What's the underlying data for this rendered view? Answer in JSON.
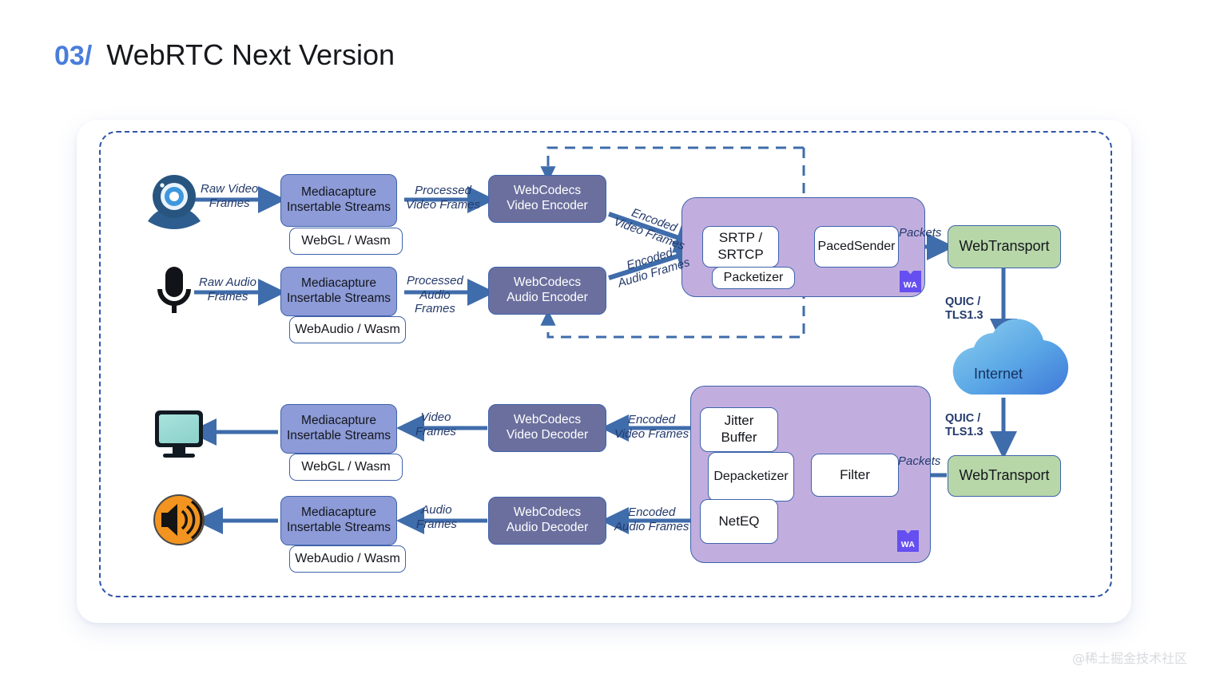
{
  "slide": {
    "number": "03/",
    "title": "WebRTC Next Version",
    "watermark": "@稀土掘金技术社区",
    "accent_blue": "#4a7ddb",
    "frame_blue": "#2f55a4",
    "mediacapture_fill": "#8d9bd8",
    "codec_fill": "#6b6f9e",
    "container_fill": "#c1aedf",
    "webtransport_fill": "#b7d7a8",
    "arrow_color": "#3f6cab",
    "wasm_badge_color": "#654ff0"
  },
  "send_path": {
    "camera_icon": "webcam-icon",
    "mic_icon": "microphone-icon",
    "video_capture": {
      "line1": "Mediacapture",
      "line2": "Insertable Streams",
      "sub": "WebGL / Wasm"
    },
    "audio_capture": {
      "line1": "Mediacapture",
      "line2": "Insertable Streams",
      "sub": "WebAudio / Wasm"
    },
    "video_encoder": {
      "line1": "WebCodecs",
      "line2": "Video Encoder"
    },
    "audio_encoder": {
      "line1": "WebCodecs",
      "line2": "Audio Encoder"
    },
    "labels": {
      "raw_video": "Raw Video\nFrames",
      "raw_video_l1": "Raw Video",
      "raw_video_l2": "Frames",
      "raw_audio_l1": "Raw Audio",
      "raw_audio_l2": "Frames",
      "processed_video_l1": "Processed",
      "processed_video_l2": "Video Frames",
      "processed_audio_l1": "Processed",
      "processed_audio_l2": "Audio",
      "processed_audio_l3": "Frames",
      "encoded_video_l1": "Encoded",
      "encoded_video_l2": "Video Frames",
      "encoded_audio_l1": "Encoded",
      "encoded_audio_l2": "Audio Frames",
      "packets": "Packets"
    },
    "transport_stack": {
      "srtp": "SRTP /\nSRTCP",
      "srtp_l1": "SRTP /",
      "srtp_l2": "SRTCP",
      "packetizer": "Packetizer",
      "paced_sender": "PacedSender",
      "wasm_badge": "WA"
    },
    "webtransport": "WebTransport"
  },
  "network": {
    "quic_upper_l1": "QUIC /",
    "quic_upper_l2": "TLS1.3",
    "quic_lower_l1": "QUIC /",
    "quic_lower_l2": "TLS1.3",
    "cloud_label": "Internet",
    "cloud_icon": "cloud-icon"
  },
  "receive_path": {
    "screen_icon": "monitor-icon",
    "speaker_icon": "speaker-icon",
    "webtransport": "WebTransport",
    "receive_stack": {
      "jitter_buffer_l1": "Jitter",
      "jitter_buffer_l2": "Buffer",
      "depacketizer": "Depacketizer",
      "neteq": "NetEQ",
      "filter": "Filter",
      "wasm_badge": "WA"
    },
    "video_decoder": {
      "line1": "WebCodecs",
      "line2": "Video Decoder"
    },
    "audio_decoder": {
      "line1": "WebCodecs",
      "line2": "Audio Decoder"
    },
    "video_render": {
      "line1": "Mediacapture",
      "line2": "Insertable Streams",
      "sub": "WebGL / Wasm"
    },
    "audio_render": {
      "line1": "Mediacapture",
      "line2": "Insertable Streams",
      "sub": "WebAudio / Wasm"
    },
    "labels": {
      "packets": "Packets",
      "encoded_video_l1": "Encoded",
      "encoded_video_l2": "Video Frames",
      "encoded_audio_l1": "Encoded",
      "encoded_audio_l2": "Audio Frames",
      "video_frames_l1": "Video",
      "video_frames_l2": "Frames",
      "audio_frames_l1": "Audio",
      "audio_frames_l2": "Frames"
    }
  }
}
